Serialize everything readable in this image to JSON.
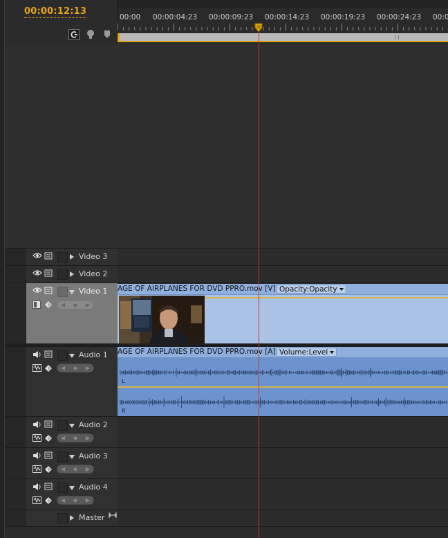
{
  "timecode": "00:00:12:13",
  "ruler": {
    "labels": [
      "00:00",
      "00:00:04:23",
      "00:00:09:23",
      "00:00:14:23",
      "00:00:19:23",
      "00:00:24:23",
      "00:00"
    ]
  },
  "header_icons": [
    "snap-icon",
    "marker-icon",
    "add-marker-icon"
  ],
  "tracks": {
    "video3": {
      "name": "Video 3"
    },
    "video2": {
      "name": "Video 2"
    },
    "video1": {
      "name": "Video 1",
      "clip_title": "AGE OF AIRPLANES FOR DVD PPRO.mov [V]",
      "param": "Opacity:Opacity"
    },
    "audio1": {
      "name": "Audio 1",
      "clip_title": "AGE OF AIRPLANES FOR DVD PPRO.mov [A]",
      "param": "Volume:Level",
      "left_label": "L",
      "right_label": "R"
    },
    "audio2": {
      "name": "Audio 2"
    },
    "audio3": {
      "name": "Audio 3"
    },
    "audio4": {
      "name": "Audio 4"
    },
    "master": {
      "name": "Master"
    }
  },
  "colors": {
    "timecode": "#e8a317",
    "playhead": "#c8382a",
    "video_clip": "#a9c2e6",
    "audio_clip": "#7fa3d3"
  }
}
